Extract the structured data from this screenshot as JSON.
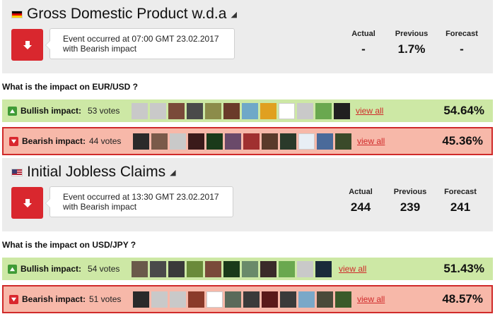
{
  "events": [
    {
      "flag": "de",
      "title": "Gross Domestic Product w.d.a",
      "signal_icon": "signal-icon",
      "callout_line1": "Event occurred at 07:00 GMT 23.02.2017",
      "callout_line2": "with Bearish impact",
      "actual_label": "Actual",
      "actual": "-",
      "previous_label": "Previous",
      "previous": "1.7%",
      "forecast_label": "Forecast",
      "forecast": "-",
      "question": "What is the impact on EUR/USD ?",
      "bullish": {
        "label": "Bullish impact:",
        "votes": "53 votes",
        "view_all": "view all",
        "percent": "54.64%"
      },
      "bearish": {
        "label": "Bearish impact:",
        "votes": "44 votes",
        "view_all": "view all",
        "percent": "45.36%"
      }
    },
    {
      "flag": "us",
      "title": "Initial Jobless Claims",
      "signal_icon": "signal-icon",
      "callout_line1": "Event occurred at 13:30 GMT 23.02.2017",
      "callout_line2": "with Bearish impact",
      "actual_label": "Actual",
      "actual": "244",
      "previous_label": "Previous",
      "previous": "239",
      "forecast_label": "Forecast",
      "forecast": "241",
      "question": "What is the impact on USD/JPY ?",
      "bullish": {
        "label": "Bullish impact:",
        "votes": "54 votes",
        "view_all": "view all",
        "percent": "51.43%"
      },
      "bearish": {
        "label": "Bearish impact:",
        "votes": "51 votes",
        "view_all": "view all",
        "percent": "48.57%"
      }
    }
  ],
  "avatar_colors": {
    "row1": [
      "#c9c9c9",
      "#c9c9c9",
      "#7a4a3a",
      "#4a4a4a",
      "#8c8c4a",
      "#6a3a2a",
      "#6fa8c8",
      "#e0a020",
      "#ffffff",
      "#c9c9c9",
      "#6aa84f",
      "#202020"
    ],
    "row2": [
      "#2a2a2a",
      "#7a5a4a",
      "#c9c9c9",
      "#3a1a1a",
      "#1a3a1a",
      "#6a4a6a",
      "#a03030",
      "#5a3a2a",
      "#2a3a2a",
      "#e8eef5",
      "#4a6a9a",
      "#3a4a2a"
    ],
    "row3": [
      "#6a5a4a",
      "#4a4a4a",
      "#3a3a3a",
      "#6a8a3a",
      "#7a4a3a",
      "#1a3a1a",
      "#6a8a6a",
      "#3a2a2a",
      "#6aa84f",
      "#c9c9c9",
      "#1a2a3a"
    ],
    "row4": [
      "#2a2a2a",
      "#c9c9c9",
      "#c9c9c9",
      "#8a3a2a",
      "#ffffff",
      "#5a6a5a",
      "#3a3a3a",
      "#5a1a1a",
      "#3a3a3a",
      "#7aa8c8",
      "#4a4a3a",
      "#3a5a2a"
    ]
  }
}
